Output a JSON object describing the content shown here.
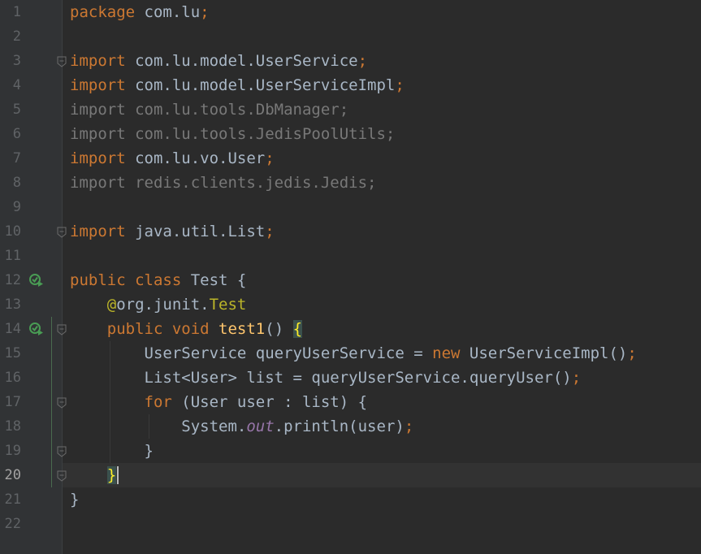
{
  "editor": {
    "current_line": "20",
    "lines": [
      {
        "num": "1",
        "segments": [
          {
            "t": "package ",
            "c": "kw"
          },
          {
            "t": "com.lu",
            "c": "pkg"
          },
          {
            "t": ";",
            "c": "semi"
          }
        ]
      },
      {
        "num": "2",
        "segments": []
      },
      {
        "num": "3",
        "segments": [
          {
            "t": "import ",
            "c": "kw"
          },
          {
            "t": "com.lu.model.UserService",
            "c": "pkg"
          },
          {
            "t": ";",
            "c": "semi"
          }
        ]
      },
      {
        "num": "4",
        "segments": [
          {
            "t": "import ",
            "c": "kw"
          },
          {
            "t": "com.lu.model.UserServiceImpl",
            "c": "pkg"
          },
          {
            "t": ";",
            "c": "semi"
          }
        ]
      },
      {
        "num": "5",
        "segments": [
          {
            "t": "import com.lu.tools.DbManager;",
            "c": "unused"
          }
        ]
      },
      {
        "num": "6",
        "segments": [
          {
            "t": "import com.lu.tools.JedisPoolUtils;",
            "c": "unused"
          }
        ]
      },
      {
        "num": "7",
        "segments": [
          {
            "t": "import ",
            "c": "kw"
          },
          {
            "t": "com.lu.vo.User",
            "c": "pkg"
          },
          {
            "t": ";",
            "c": "semi"
          }
        ]
      },
      {
        "num": "8",
        "segments": [
          {
            "t": "import redis.clients.jedis.Jedis;",
            "c": "unused"
          }
        ]
      },
      {
        "num": "9",
        "segments": []
      },
      {
        "num": "10",
        "segments": [
          {
            "t": "import ",
            "c": "kw"
          },
          {
            "t": "java.util.List",
            "c": "pkg"
          },
          {
            "t": ";",
            "c": "semi"
          }
        ]
      },
      {
        "num": "11",
        "segments": []
      },
      {
        "num": "12",
        "segments": [
          {
            "t": "public class ",
            "c": "kw"
          },
          {
            "t": "Test {",
            "c": "pkg"
          }
        ]
      },
      {
        "num": "13",
        "segments": [
          {
            "t": "    "
          },
          {
            "t": "@",
            "c": "annot"
          },
          {
            "t": "org.junit.",
            "c": "pkg"
          },
          {
            "t": "Test",
            "c": "annot"
          }
        ]
      },
      {
        "num": "14",
        "segments": [
          {
            "t": "    "
          },
          {
            "t": "public void ",
            "c": "kw"
          },
          {
            "t": "test1",
            "c": "method"
          },
          {
            "t": "() ",
            "c": "pkg"
          },
          {
            "t": "{",
            "c": "brace-match"
          }
        ]
      },
      {
        "num": "15",
        "segments": [
          {
            "t": "        UserService queryUserService = ",
            "c": "pkg"
          },
          {
            "t": "new ",
            "c": "kw"
          },
          {
            "t": "UserServiceImpl()",
            "c": "pkg"
          },
          {
            "t": ";",
            "c": "semi"
          }
        ]
      },
      {
        "num": "16",
        "segments": [
          {
            "t": "        List<User> list = queryUserService.queryUser()",
            "c": "pkg"
          },
          {
            "t": ";",
            "c": "semi"
          }
        ]
      },
      {
        "num": "17",
        "segments": [
          {
            "t": "        "
          },
          {
            "t": "for ",
            "c": "kw"
          },
          {
            "t": "(User user : list) {",
            "c": "pkg"
          }
        ]
      },
      {
        "num": "18",
        "segments": [
          {
            "t": "            System.",
            "c": "pkg"
          },
          {
            "t": "out",
            "c": "field"
          },
          {
            "t": ".println(user)",
            "c": "pkg"
          },
          {
            "t": ";",
            "c": "semi"
          }
        ]
      },
      {
        "num": "19",
        "segments": [
          {
            "t": "        }",
            "c": "pkg"
          }
        ]
      },
      {
        "num": "20",
        "segments": [
          {
            "t": "    "
          },
          {
            "t": "}",
            "c": "brace-match"
          }
        ]
      },
      {
        "num": "21",
        "segments": [
          {
            "t": "}",
            "c": "pkg"
          }
        ]
      },
      {
        "num": "22",
        "segments": []
      }
    ],
    "gutter_icons": [
      {
        "line": "12",
        "name": "run-test-icon"
      },
      {
        "line": "14",
        "name": "run-test-icon"
      }
    ],
    "fold_markers": [
      "3",
      "10",
      "14",
      "17",
      "19",
      "20"
    ],
    "colors": {
      "background": "#2b2b2b",
      "keyword": "#cc7832",
      "text": "#a9b7c6",
      "unused_import": "#787878",
      "annotation": "#bbb529",
      "method_decl": "#ffc66d",
      "static_field": "#9876aa",
      "line_number": "#606366",
      "run_icon": "#499c54"
    }
  }
}
